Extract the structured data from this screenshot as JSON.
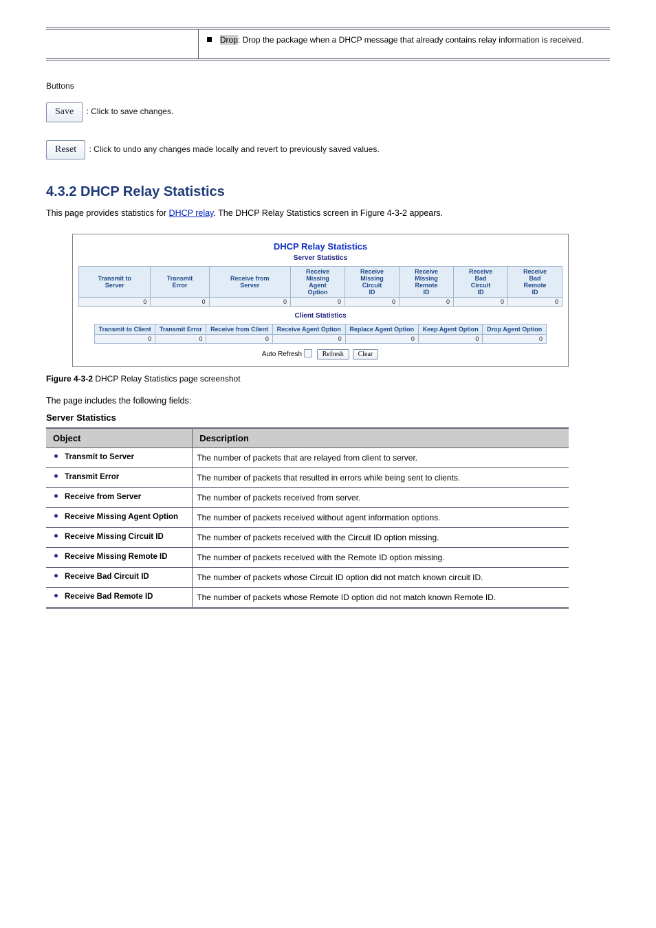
{
  "top": {
    "drop_label": "Drop",
    "drop_desc": ": Drop the package when a DHCP message that already contains relay information is received."
  },
  "buttons": {
    "intro": "Buttons",
    "save_label": "Save",
    "save_desc": ": Click to save changes.",
    "reset_label": "Reset",
    "reset_desc": ": Click to undo any changes made locally and revert to previously saved values."
  },
  "section": {
    "heading": "4.3.2 DHCP Relay Statistics",
    "body_1": "This page provides statistics for ",
    "body_link": "DHCP relay",
    "body_2": ". The DHCP Relay Statistics screen in ",
    "body_figref": "Figure 4-3-2",
    "body_3": " appears."
  },
  "shot": {
    "title": "DHCP Relay Statistics",
    "sub1": "Server Statistics",
    "srv_headers": [
      "Transmit to Server",
      "Transmit Error",
      "Receive from Server",
      "Receive Missing Agent Option",
      "Receive Missing Circuit ID",
      "Receive Missing Remote ID",
      "Receive Bad Circuit ID",
      "Receive Bad Remote ID"
    ],
    "srv_vals": [
      "0",
      "0",
      "0",
      "0",
      "0",
      "0",
      "0",
      "0"
    ],
    "sub2": "Client Statistics",
    "cli_headers": [
      "Transmit to Client",
      "Transmit Error",
      "Receive from Client",
      "Receive Agent Option",
      "Replace Agent Option",
      "Keep Agent Option",
      "Drop Agent Option"
    ],
    "cli_vals": [
      "0",
      "0",
      "0",
      "0",
      "0",
      "0",
      "0"
    ],
    "auto_label": "Auto Refresh",
    "refresh": "Refresh",
    "clear": "Clear"
  },
  "fig_caption_strong": "Figure 4-3-2",
  "fig_caption_rest": " DHCP Relay Statistics page screenshot",
  "desc_intro": "The page includes the following fields:",
  "desc_head": {
    "obj": "Object",
    "desc": "Description"
  },
  "server_stats_label": "Server Statistics",
  "rows": [
    {
      "obj": "Transmit to Server",
      "desc": "The number of packets that are relayed from client to server."
    },
    {
      "obj": "Transmit Error",
      "desc": "The number of packets that resulted in errors while being sent to clients."
    },
    {
      "obj": "Receive from Server",
      "desc": "The number of packets received from server."
    },
    {
      "obj": "Receive Missing Agent Option",
      "desc": "The number of packets received without agent information options."
    },
    {
      "obj": "Receive Missing Circuit ID",
      "desc": "The number of packets received with the Circuit ID option missing."
    },
    {
      "obj": "Receive Missing Remote ID",
      "desc": "The number of packets received with the Remote ID option missing."
    },
    {
      "obj": "Receive Bad Circuit ID",
      "desc": "The number of packets whose Circuit ID option did not match known circuit ID."
    },
    {
      "obj": "Receive Bad Remote ID",
      "desc": "The number of packets whose Remote ID option did not match known Remote ID."
    }
  ]
}
